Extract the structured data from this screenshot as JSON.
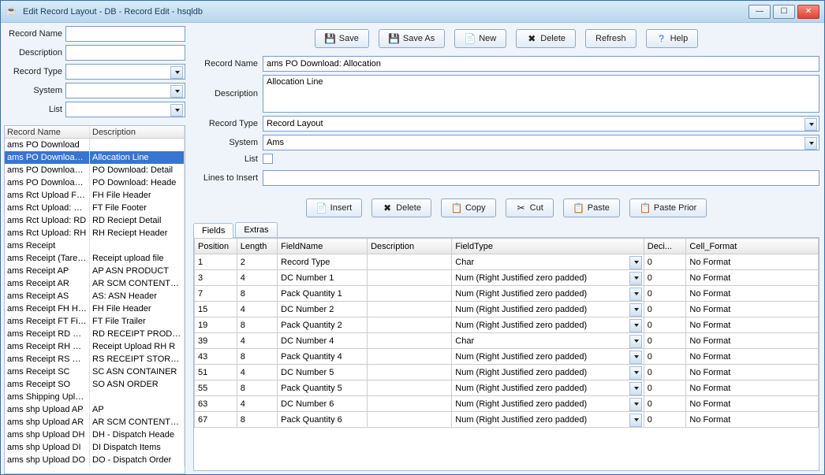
{
  "titlebar": {
    "title": "Edit Record Layout - DB - Record Edit - hsqldb"
  },
  "left_filter": {
    "record_name_label": "Record Name",
    "description_label": "Description",
    "record_type_label": "Record Type",
    "system_label": "System",
    "list_label": "List"
  },
  "record_list": {
    "col_name": "Record Name",
    "col_desc": "Description",
    "rows": [
      {
        "n": "ams PO Download",
        "d": ""
      },
      {
        "n": "ams PO Download: …",
        "d": "Allocation Line",
        "sel": true
      },
      {
        "n": "ams PO Download: …",
        "d": "PO Download: Detail"
      },
      {
        "n": "ams PO Download: …",
        "d": "PO Download: Heade"
      },
      {
        "n": "ams Rct Upload FH …",
        "d": "FH File Header"
      },
      {
        "n": "ams Rct Upload: FT…",
        "d": "FT File Footer"
      },
      {
        "n": "ams Rct Upload: RD",
        "d": "RD Reciept Detail"
      },
      {
        "n": "ams Rct Upload: RH",
        "d": "RH Reciept Header"
      },
      {
        "n": "ams Receipt",
        "d": ""
      },
      {
        "n": "ams Receipt (Taret …",
        "d": "Receipt upload file"
      },
      {
        "n": "ams Receipt AP",
        "d": "AP ASN PRODUCT"
      },
      {
        "n": "ams Receipt AR",
        "d": "AR SCM CONTENTS C"
      },
      {
        "n": "ams Receipt AS",
        "d": "AS: ASN Header"
      },
      {
        "n": "ams Receipt FH He…",
        "d": "FH File Header"
      },
      {
        "n": "ams Receipt FT File …",
        "d": "FT File Trailer"
      },
      {
        "n": "ams Receipt RD Re…",
        "d": "RD RECEIPT PRODUC"
      },
      {
        "n": "ams Receipt RH Re…",
        "d": "Receipt Upload RH R"
      },
      {
        "n": "ams Receipt RS Rec…",
        "d": "RS RECEIPT STORE A"
      },
      {
        "n": "ams Receipt SC",
        "d": "SC ASN CONTAINER"
      },
      {
        "n": "ams Receipt SO",
        "d": "SO ASN ORDER"
      },
      {
        "n": "ams Shipping Upload",
        "d": ""
      },
      {
        "n": "ams shp Upload AP",
        "d": "AP"
      },
      {
        "n": "ams shp Upload AR",
        "d": "AR SCM CONTENTS C"
      },
      {
        "n": "ams shp Upload DH",
        "d": "DH - Dispatch Heade"
      },
      {
        "n": "ams shp Upload DI",
        "d": "DI Dispatch Items"
      },
      {
        "n": "ams shp Upload DO",
        "d": "DO - Dispatch Order"
      }
    ]
  },
  "toolbar": {
    "save": "Save",
    "saveas": "Save As",
    "new": "New",
    "delete": "Delete",
    "refresh": "Refresh",
    "help": "Help"
  },
  "details": {
    "record_name_label": "Record Name",
    "record_name_value": "ams PO Download: Allocation",
    "description_label": "Description",
    "description_value": "Allocation Line",
    "record_type_label": "Record Type",
    "record_type_value": "Record Layout",
    "system_label": "System",
    "system_value": "Ams",
    "list_label": "List",
    "lines_to_insert_label": "Lines to Insert",
    "lines_to_insert_value": ""
  },
  "toolbar2": {
    "insert": "Insert",
    "delete": "Delete",
    "copy": "Copy",
    "cut": "Cut",
    "paste": "Paste",
    "paste_prior": "Paste Prior"
  },
  "tabs": {
    "fields": "Fields",
    "extras": "Extras"
  },
  "grid": {
    "headers": {
      "position": "Position",
      "length": "Length",
      "fieldname": "FieldName",
      "description": "Description",
      "fieldtype": "FieldType",
      "deci": "Deci...",
      "cellformat": "Cell_Format"
    },
    "rows": [
      {
        "pos": "1",
        "len": "2",
        "name": "Record Type",
        "desc": "",
        "type": "Char",
        "deci": "0",
        "fmt": "No Format"
      },
      {
        "pos": "3",
        "len": "4",
        "name": "DC Number 1",
        "desc": "",
        "type": "Num (Right Justified zero padded)",
        "deci": "0",
        "fmt": "No Format"
      },
      {
        "pos": "7",
        "len": "8",
        "name": "Pack Quantity 1",
        "desc": "",
        "type": "Num (Right Justified zero padded)",
        "deci": "0",
        "fmt": "No Format"
      },
      {
        "pos": "15",
        "len": "4",
        "name": "DC Number 2",
        "desc": "",
        "type": "Num (Right Justified zero padded)",
        "deci": "0",
        "fmt": "No Format"
      },
      {
        "pos": "19",
        "len": "8",
        "name": "Pack Quantity 2",
        "desc": "",
        "type": "Num (Right Justified zero padded)",
        "deci": "0",
        "fmt": "No Format"
      },
      {
        "pos": "39",
        "len": "4",
        "name": "DC Number 4",
        "desc": "",
        "type": "Char",
        "deci": "0",
        "fmt": "No Format"
      },
      {
        "pos": "43",
        "len": "8",
        "name": "Pack Quantity 4",
        "desc": "",
        "type": "Num (Right Justified zero padded)",
        "deci": "0",
        "fmt": "No Format"
      },
      {
        "pos": "51",
        "len": "4",
        "name": "DC Number 5",
        "desc": "",
        "type": "Num (Right Justified zero padded)",
        "deci": "0",
        "fmt": "No Format"
      },
      {
        "pos": "55",
        "len": "8",
        "name": "Pack Quantity 5",
        "desc": "",
        "type": "Num (Right Justified zero padded)",
        "deci": "0",
        "fmt": "No Format"
      },
      {
        "pos": "63",
        "len": "4",
        "name": "DC Number 6",
        "desc": "",
        "type": "Num (Right Justified zero padded)",
        "deci": "0",
        "fmt": "No Format"
      },
      {
        "pos": "67",
        "len": "8",
        "name": "Pack Quantity 6",
        "desc": "",
        "type": "Num (Right Justified zero padded)",
        "deci": "0",
        "fmt": "No Format"
      }
    ]
  }
}
